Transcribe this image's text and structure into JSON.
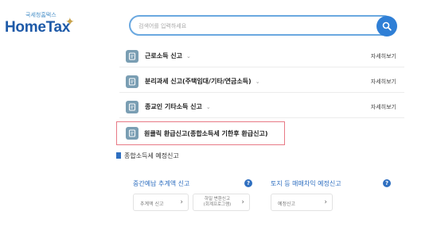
{
  "header": {
    "logo_sub": "국세청홈택스",
    "logo_main": "HomeTax",
    "search_placeholder": "검색어를 입력하세요"
  },
  "rows": [
    {
      "label": "근로소득 신고",
      "chevron": "⌄",
      "more": "자세히보기"
    },
    {
      "label": "분리과세 신고(주택임대/기타/연금소득)",
      "chevron": "⌄",
      "more": "자세히보기"
    },
    {
      "label": "종교인 기타소득 신고",
      "chevron": "⌄",
      "more": "자세히보기"
    },
    {
      "label": "원클릭 환급신고(종합소득세 기한후 환급신고)"
    }
  ],
  "schedule": {
    "label": "종합소득세 예정신고"
  },
  "sections": [
    {
      "title": "중간예납 추계액 신고",
      "buttons": [
        {
          "label": "추계액 신고"
        },
        {
          "label_line1": "하일 변환신고",
          "label_line2": "(회계프로그램)"
        }
      ]
    },
    {
      "title": "토지 등 매매차익 예정신고",
      "buttons": [
        {
          "label": "예정신고"
        }
      ]
    }
  ],
  "colors": {
    "accent": "#2f7fd6",
    "logo": "#1e5aa8",
    "highlight_border": "#e87a86",
    "icon_bg": "#7a9eb3"
  },
  "icons": {
    "search": "search-icon",
    "row": "document-icon",
    "help": "question-icon",
    "arrow": "chevron-right-icon",
    "schedule": "bookmark-icon"
  }
}
